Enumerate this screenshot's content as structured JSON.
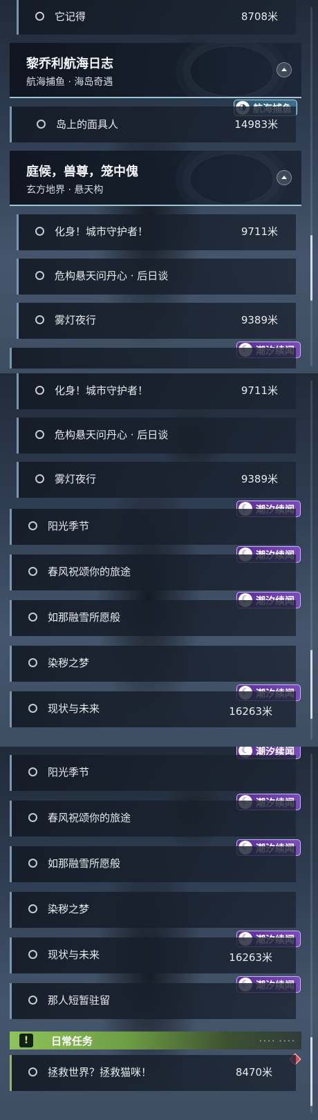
{
  "colors": {
    "row_accent": "#7b97b0",
    "badge_purple": "#6a3fb0",
    "daily_green": "#8fc35a",
    "alert_red": "#d94a5a"
  },
  "badges": {
    "tide": {
      "label": "潮汐续闻",
      "icon": "tide-wave-icon"
    },
    "voyage": {
      "label": "航海捕鱼",
      "icon": "voyage-fish-icon"
    }
  },
  "panel1": {
    "top_item": {
      "name": "它记得",
      "distance": "8708米"
    },
    "group_voyage": {
      "title": "黎乔利航海日志",
      "subtitle": "航海捕鱼 · 海岛奇遇",
      "items": [
        {
          "name": "岛上的面具人",
          "distance": "14983米"
        }
      ]
    },
    "group_court": {
      "title": "庭候，兽尊，笼中傀",
      "subtitle": "玄方地界 · 悬天构",
      "items": [
        {
          "name": "化身！城市守护者！",
          "distance": "9711米"
        },
        {
          "name": "危构悬天问丹心 · 后日谈",
          "distance": ""
        },
        {
          "name": "雾灯夜行",
          "distance": "9389米"
        }
      ]
    }
  },
  "panel2": {
    "items": [
      {
        "name": "化身！城市守护者！",
        "distance": "9711米"
      },
      {
        "name": "危构悬天问丹心 · 后日谈",
        "distance": ""
      },
      {
        "name": "雾灯夜行",
        "distance": "9389米"
      },
      {
        "name": "阳光季节",
        "distance": ""
      },
      {
        "name": "春风祝颂你的旅途",
        "distance": ""
      },
      {
        "name": "如那融雪所愿般",
        "distance": ""
      },
      {
        "name": "染秽之梦",
        "distance": ""
      },
      {
        "name": "现状与未来",
        "distance": "16263米"
      }
    ]
  },
  "panel3": {
    "items": [
      {
        "name": "阳光季节",
        "distance": ""
      },
      {
        "name": "春风祝颂你的旅途",
        "distance": ""
      },
      {
        "name": "如那融雪所愿般",
        "distance": ""
      },
      {
        "name": "染秽之梦",
        "distance": ""
      },
      {
        "name": "现状与未来",
        "distance": "16263米"
      },
      {
        "name": "那人短暂驻留",
        "distance": ""
      }
    ],
    "daily": {
      "title": "日常任务",
      "icon": "exclamation-icon",
      "items": [
        {
          "name": "拯救世界？拯救猫咪！",
          "distance": "8470米"
        }
      ]
    }
  }
}
